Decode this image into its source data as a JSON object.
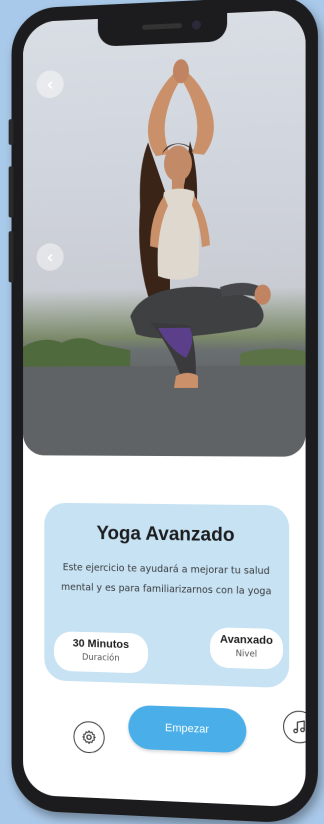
{
  "screen": {
    "back_icon_glyph": "‹",
    "title": "Yoga Avanzado",
    "description": "Este ejercicio te ayudará a mejorar tu salud mental y es para familiarizarnos con la yoga",
    "duration": {
      "value": "30 Minutos",
      "label": "Duración"
    },
    "level": {
      "value": "Avanxado",
      "label": "Nivel"
    },
    "start_label": "Empezar",
    "icons": [
      "back-icon",
      "settings-icon",
      "music-note-icon"
    ]
  },
  "colors": {
    "accent": "#4aaee8",
    "card": "#c6e2f3",
    "background": "#a9c9ea"
  }
}
